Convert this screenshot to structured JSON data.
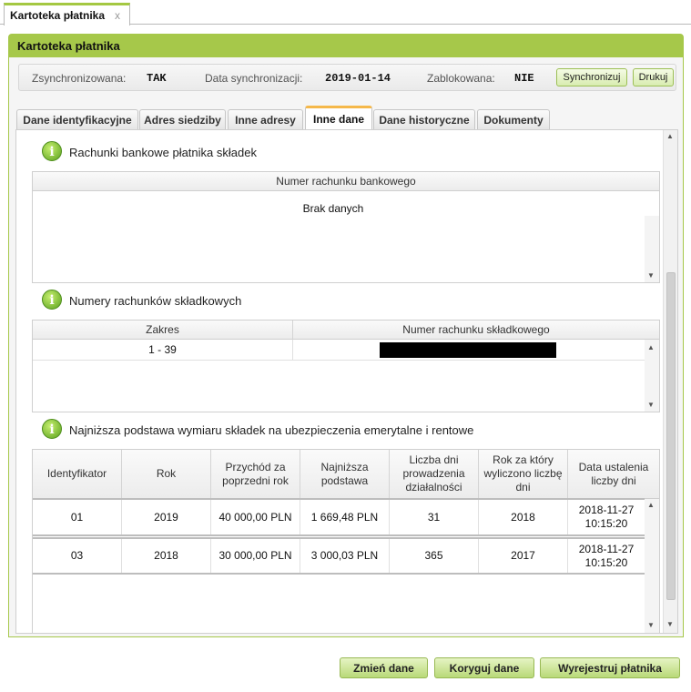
{
  "top_tab": {
    "label": "Kartoteka płatnika",
    "close": "x"
  },
  "panel": {
    "title": "Kartoteka płatnika"
  },
  "sync": {
    "synced_label": "Zsynchronizowana:",
    "synced_value": "TAK",
    "date_label": "Data synchronizacji:",
    "date_value": "2019-01-14",
    "locked_label": "Zablokowana:",
    "locked_value": "NIE",
    "sync_button": "Synchronizuj",
    "print_button": "Drukuj"
  },
  "tabs": [
    "Dane identyfikacyjne",
    "Adres siedziby",
    "Inne adresy",
    "Inne dane",
    "Dane historyczne",
    "Dokumenty"
  ],
  "active_tab": "Inne dane",
  "bank_accounts": {
    "title": "Rachunki bankowe płatnika składek",
    "column": "Numer rachunku bankowego",
    "empty": "Brak danych"
  },
  "contribution_accounts": {
    "title": "Numery rachunków składkowych",
    "columns": [
      "Zakres",
      "Numer rachunku składkowego"
    ],
    "rows": [
      {
        "range": "1 - 39",
        "number": ""
      }
    ]
  },
  "min_base": {
    "title": "Najniższa podstawa wymiaru składek na ubezpieczenia emerytalne i rentowe",
    "columns": [
      "Identyfikator",
      "Rok",
      "Przychód za poprzedni rok",
      "Najniższa podstawa",
      "Liczba dni prowadzenia działalności",
      "Rok za który wyliczono liczbę dni",
      "Data ustalenia liczby dni"
    ],
    "rows": [
      {
        "id": "01",
        "year": "2019",
        "income": "40 000,00 PLN",
        "base": "1 669,48 PLN",
        "days": "31",
        "days_year": "2018",
        "date": "2018-11-27",
        "time": "10:15:20"
      },
      {
        "id": "03",
        "year": "2018",
        "income": "30 000,00 PLN",
        "base": "3 000,03 PLN",
        "days": "365",
        "days_year": "2017",
        "date": "2018-11-27",
        "time": "10:15:20"
      }
    ]
  },
  "footer": {
    "change": "Zmień dane",
    "correct": "Koryguj dane",
    "deregister": "Wyrejestruj płatnika"
  }
}
